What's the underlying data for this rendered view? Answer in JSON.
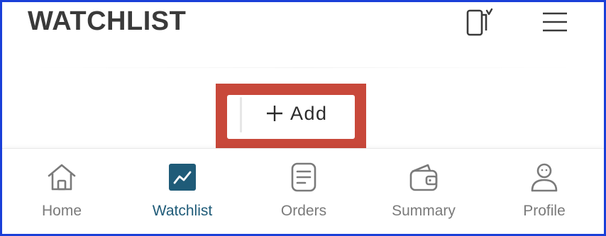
{
  "header": {
    "title": "WATCHLIST",
    "icons": {
      "device_icon": "phone-rotate-icon",
      "menu_icon": "hamburger-menu-icon"
    }
  },
  "main": {
    "add_button": {
      "label": "Add",
      "icon": "plus-icon"
    },
    "highlight_color": "#c8483a"
  },
  "bottom_nav": {
    "active": "Watchlist",
    "active_color": "#1f5b78",
    "inactive_color": "#7a7a7a",
    "items": [
      {
        "label": "Home",
        "icon": "home-icon"
      },
      {
        "label": "Watchlist",
        "icon": "watchlist-chart-icon"
      },
      {
        "label": "Orders",
        "icon": "orders-document-icon"
      },
      {
        "label": "Summary",
        "icon": "wallet-icon"
      },
      {
        "label": "Profile",
        "icon": "profile-icon"
      }
    ]
  }
}
